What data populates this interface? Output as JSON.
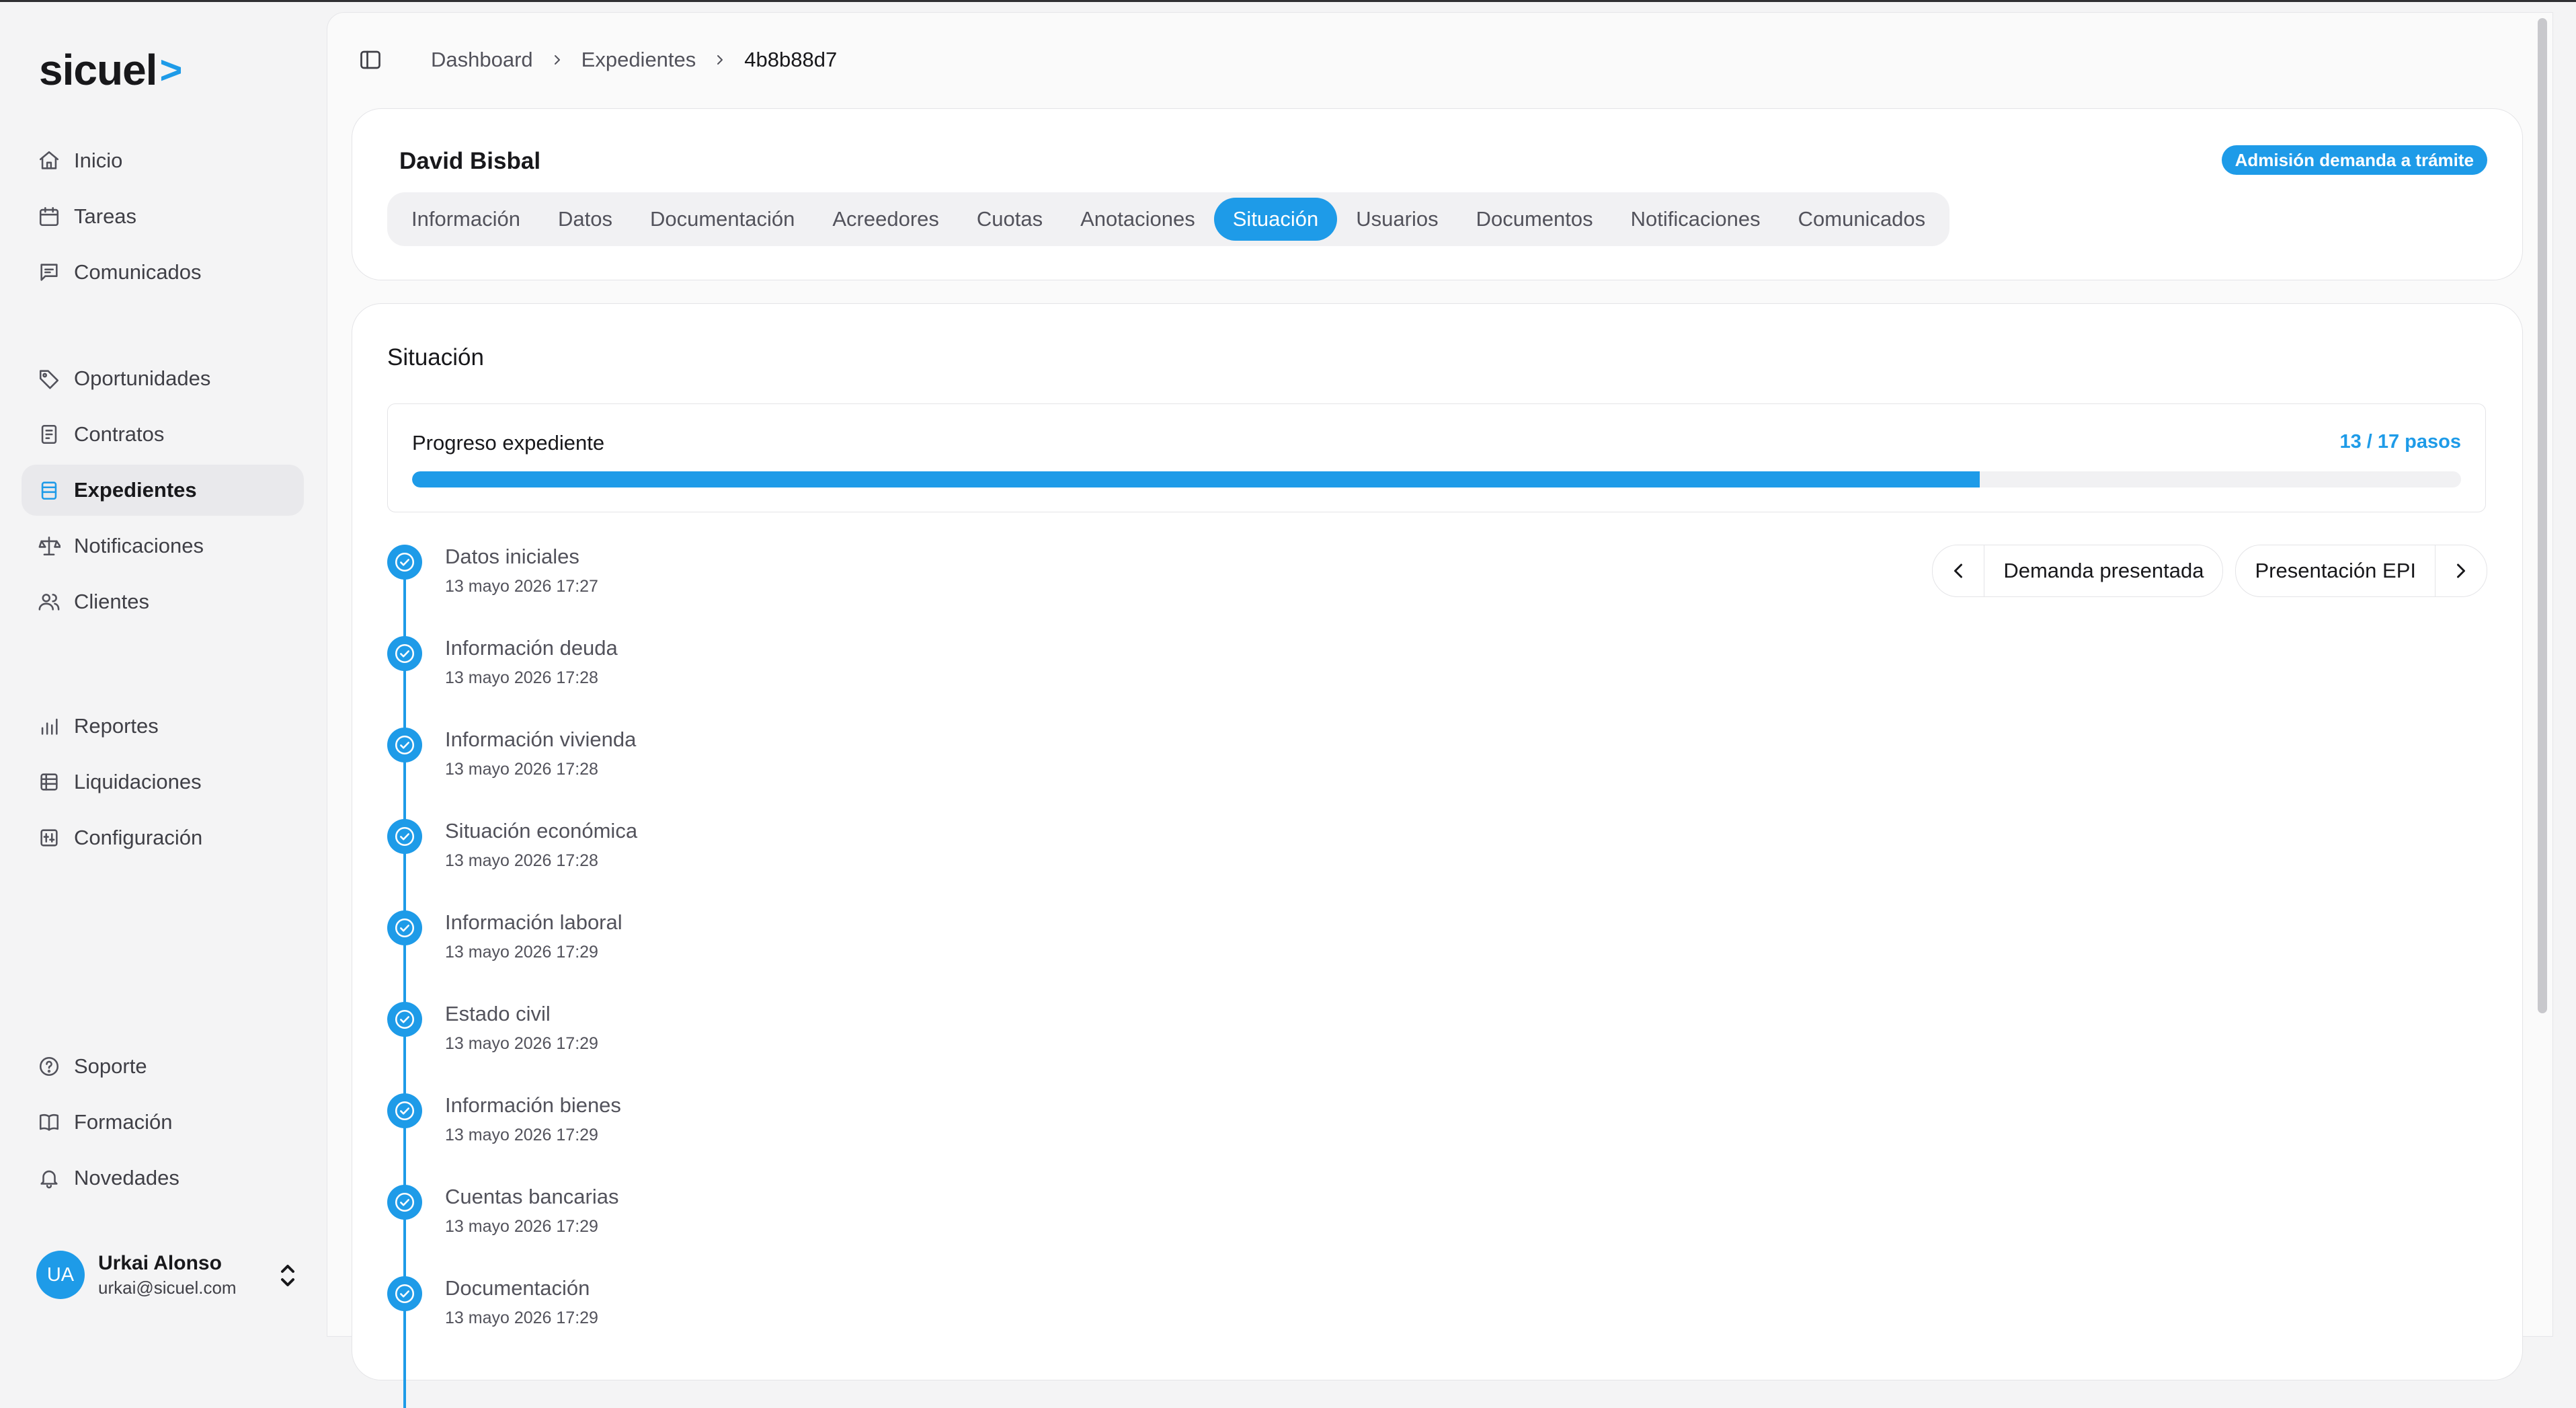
{
  "app": {
    "logo_text": "sicuel",
    "logo_mark": ">"
  },
  "sidebar": {
    "groups": [
      [
        {
          "label": "Inicio",
          "icon": "home-icon"
        },
        {
          "label": "Tareas",
          "icon": "calendar-icon"
        },
        {
          "label": "Comunicados",
          "icon": "message-icon"
        }
      ],
      [
        {
          "label": "Oportunidades",
          "icon": "tag-icon"
        },
        {
          "label": "Contratos",
          "icon": "contract-icon"
        },
        {
          "label": "Expedientes",
          "icon": "folder-icon"
        },
        {
          "label": "Notificaciones",
          "icon": "scale-icon"
        },
        {
          "label": "Clientes",
          "icon": "users-icon"
        }
      ],
      [
        {
          "label": "Reportes",
          "icon": "bar-chart-icon"
        },
        {
          "label": "Liquidaciones",
          "icon": "coins-icon"
        },
        {
          "label": "Configuración",
          "icon": "settings-icon"
        }
      ]
    ],
    "bottom": [
      {
        "label": "Soporte",
        "icon": "help-icon"
      },
      {
        "label": "Formación",
        "icon": "book-icon"
      },
      {
        "label": "Novedades",
        "icon": "bell-icon"
      }
    ],
    "active_item": "Expedientes",
    "user": {
      "initials": "UA",
      "name": "Urkai Alonso",
      "email": "urkai@sicuel.com"
    }
  },
  "breadcrumb": {
    "items": [
      "Dashboard",
      "Expedientes"
    ],
    "current": "4b8b88d7"
  },
  "header": {
    "client_name": "David Bisbal",
    "status": "Admisión demanda a trámite",
    "tabs": [
      "Información",
      "Datos",
      "Documentación",
      "Acreedores",
      "Cuotas",
      "Anotaciones",
      "Situación",
      "Usuarios",
      "Documentos",
      "Notificaciones",
      "Comunicados"
    ],
    "active_tab": "Situación"
  },
  "situation": {
    "title": "Situación",
    "progress": {
      "label": "Progreso expediente",
      "count_text": "13 / 17 pasos",
      "fraction": 0.765
    },
    "stage_nav": {
      "prev": "Demanda presentada",
      "next": "Presentación EPI"
    },
    "steps": [
      {
        "title": "Datos iniciales",
        "date": "13 mayo 2026 17:27"
      },
      {
        "title": "Información deuda",
        "date": "13 mayo 2026 17:28"
      },
      {
        "title": "Información vivienda",
        "date": "13 mayo 2026 17:28"
      },
      {
        "title": "Situación económica",
        "date": "13 mayo 2026 17:28"
      },
      {
        "title": "Información laboral",
        "date": "13 mayo 2026 17:29"
      },
      {
        "title": "Estado civil",
        "date": "13 mayo 2026 17:29"
      },
      {
        "title": "Información bienes",
        "date": "13 mayo 2026 17:29"
      },
      {
        "title": "Cuentas bancarias",
        "date": "13 mayo 2026 17:29"
      },
      {
        "title": "Documentación",
        "date": "13 mayo 2026 17:29"
      }
    ]
  },
  "colors": {
    "accent": "#1e9be8",
    "text": "#18181b",
    "muted": "#52525b",
    "bg": "#f4f4f5"
  }
}
